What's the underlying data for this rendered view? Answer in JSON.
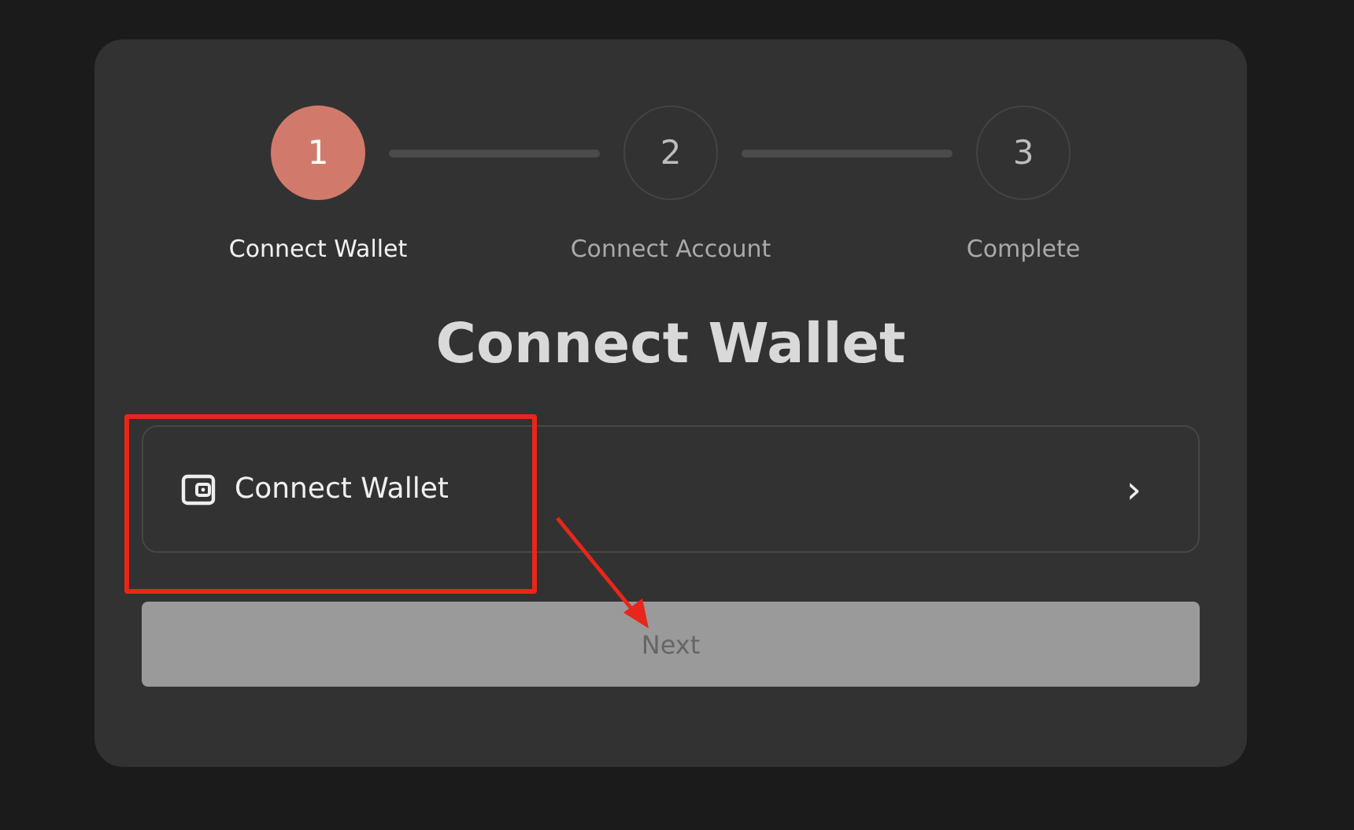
{
  "steps": [
    {
      "number": "1",
      "label": "Connect Wallet",
      "selected": true
    },
    {
      "number": "2",
      "label": "Connect Account",
      "selected": false
    },
    {
      "number": "3",
      "label": "Complete",
      "selected": false
    }
  ],
  "title": "Connect Wallet",
  "option": {
    "label": "Connect Wallet",
    "chevron": "›"
  },
  "next_button": {
    "label": "Next",
    "disabled": true
  },
  "highlight_frame": {
    "color": "#e8261c"
  },
  "arrow": {
    "color": "#e8261c"
  }
}
